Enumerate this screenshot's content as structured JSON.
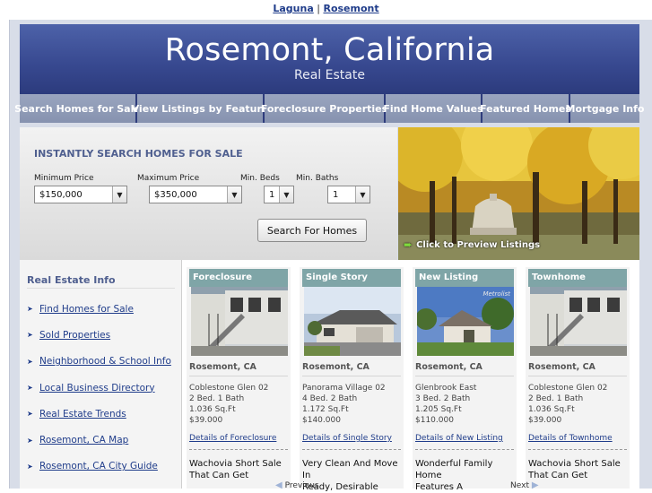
{
  "top_links": {
    "laguna": "Laguna",
    "separator": "|",
    "rosemont": "Rosemont"
  },
  "banner": {
    "title": "Rosemont, California",
    "subtitle": "Real Estate"
  },
  "nav": [
    {
      "label": "Search Homes for Sale"
    },
    {
      "label": "View Listings by Feature"
    },
    {
      "label": "Foreclosure Properties"
    },
    {
      "label": "Find Home Values"
    },
    {
      "label": "Featured Homes"
    },
    {
      "label": "Mortgage Info"
    }
  ],
  "search": {
    "heading": "INSTANTLY SEARCH HOMES FOR SALE",
    "min_price_label": "Minimum Price",
    "max_price_label": "Maximum Price",
    "min_beds_label": "Min. Beds",
    "min_baths_label": "Min. Baths",
    "min_price_value": "$150,000",
    "max_price_value": "$350,000",
    "min_beds_value": "1",
    "min_baths_value": "1",
    "button": "Search For Homes"
  },
  "photo": {
    "preview_label": "Click to Preview Listings"
  },
  "sidebar": {
    "heading": "Real Estate Info",
    "links": [
      {
        "label": "Find Homes for Sale"
      },
      {
        "label": "Sold Properties"
      },
      {
        "label": "Neighborhood & School Info"
      },
      {
        "label": "Local Business Directory"
      },
      {
        "label": "Real Estate Trends"
      },
      {
        "label": "Rosemont, CA Map"
      },
      {
        "label": "Rosemont, CA City Guide"
      }
    ]
  },
  "cards": [
    {
      "badge": "Foreclosure",
      "location": "Rosemont, CA",
      "name": "Coblestone Glen 02",
      "beds_baths": "2 Bed. 1 Bath",
      "sqft": "1.036 Sq.Ft",
      "price": "$39.000",
      "details": "Details of Foreclosure",
      "desc1": "Wachovia Short Sale",
      "desc2": "That Can Get"
    },
    {
      "badge": "Single Story",
      "location": "Rosemont, CA",
      "name": "Panorama Village 02",
      "beds_baths": "4 Bed. 2 Bath",
      "sqft": "1.172 Sq.Ft",
      "price": "$140.000",
      "details": "Details of Single Story",
      "desc1": "Very Clean And Move In",
      "desc2": "Ready, Desirable"
    },
    {
      "badge": "New Listing",
      "location": "Rosemont, CA",
      "name": "Glenbrook East",
      "beds_baths": "3 Bed. 2 Bath",
      "sqft": "1.205 Sq.Ft",
      "price": "$110.000",
      "details": "Details of New Listing",
      "desc1": "Wonderful Family Home",
      "desc2": "Features A",
      "watermark": "Metrolist"
    },
    {
      "badge": "Townhome",
      "location": "Rosemont, CA",
      "name": "Coblestone Glen 02",
      "beds_baths": "2 Bed. 1 Bath",
      "sqft": "1.036 Sq.Ft",
      "price": "$39.000",
      "details": "Details of Townhome",
      "desc1": "Wachovia Short Sale",
      "desc2": "That Can Get"
    }
  ],
  "pager": {
    "previous": "Previous",
    "next": "Next"
  }
}
